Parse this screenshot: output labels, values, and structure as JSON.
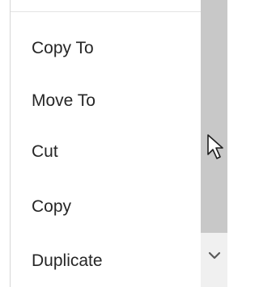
{
  "menu": {
    "items": [
      {
        "label": "Copy To"
      },
      {
        "label": "Move To"
      },
      {
        "label": "Cut"
      },
      {
        "label": "Copy"
      },
      {
        "label": "Duplicate"
      }
    ]
  },
  "scrollbar": {
    "down_arrow_icon": "chevron-down-icon",
    "thumb_color": "#c8c8c8",
    "track_color": "#f0f0f0"
  },
  "cursor": {
    "icon": "mouse-pointer-icon"
  },
  "colors": {
    "text": "#262626",
    "menu_background": "#ffffff",
    "border": "#d6d6d6"
  }
}
